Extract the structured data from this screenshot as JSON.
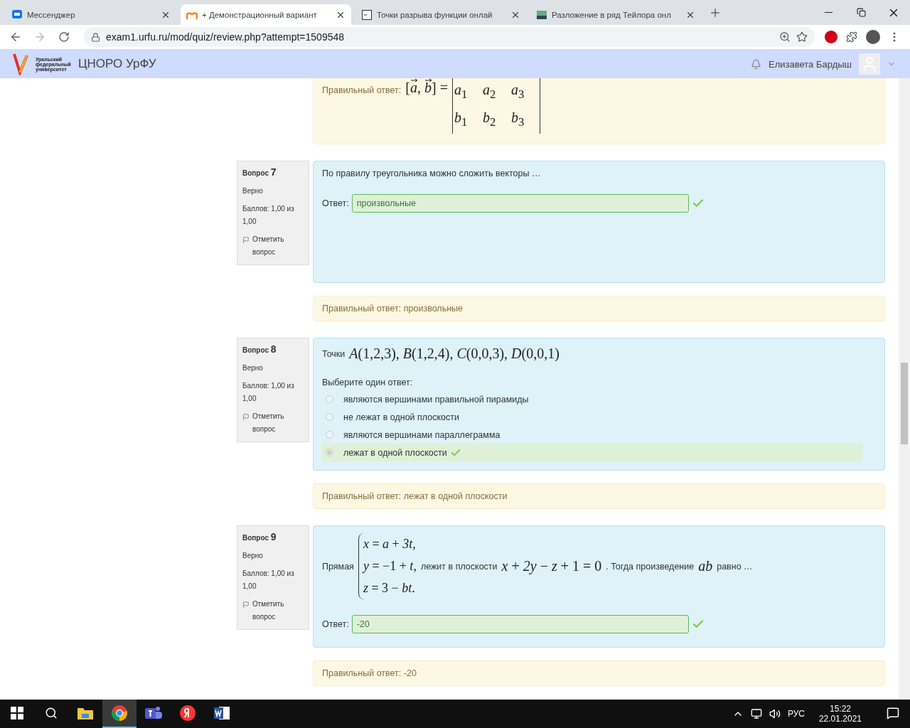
{
  "browser": {
    "tabs": [
      {
        "title": "Мессенджер",
        "selected": false
      },
      {
        "title": "+ Демонстрационный вариант",
        "selected": true
      },
      {
        "title": "Точки разрыва функции онлай",
        "selected": false
      },
      {
        "title": "Разложение в ряд Тейлора онл",
        "selected": false
      }
    ],
    "url": "exam1.urfu.ru/mod/quiz/review.php?attempt=1509548"
  },
  "site": {
    "logo_text": "Уральский федеральный университет",
    "name": "ЦНОРО УрФУ",
    "user": "Елизавета Бардыш"
  },
  "previous_feedback": {
    "label": "Правильный ответ:",
    "open": "[",
    "vectors": [
      "a",
      "b"
    ],
    "separator": ",",
    "close": "] =",
    "matrix": [
      [
        "*a*$_{1}$",
        "*a*$_{2}$",
        "*a*$_{3}$"
      ],
      [
        "*b*$_{1}$",
        "*b*$_{2}$",
        "*b*$_{3}$"
      ]
    ]
  },
  "questions": [
    {
      "kind": "short_answer",
      "label": "Вопрос",
      "number": "7",
      "status": "Верно",
      "grade": "Баллов: 1,00 из 1,00",
      "flag": "Отметить вопрос",
      "text": [
        {
          "kind": "text",
          "value": "По правилу треугольника можно сложить векторы …"
        }
      ],
      "answer_label": "Ответ:",
      "answer": "произвольные",
      "correct": true,
      "feedback": "Правильный ответ: произвольные"
    },
    {
      "kind": "multichoice",
      "label": "Вопрос",
      "number": "8",
      "status": "Верно",
      "grade": "Баллов: 1,00 из 1,00",
      "flag": "Отметить вопрос",
      "text": [
        {
          "kind": "text",
          "value": "Точки"
        },
        {
          "kind": "math",
          "value": "*A*(1,2,3), *B*(1,2,4), *C*(0,0,3), *D*(0,0,1)"
        }
      ],
      "instruction": "Выберите один ответ:",
      "options": [
        {
          "label": "являются вершинами правильной пирамиды",
          "selected": false,
          "correct": false
        },
        {
          "label": "не лежат в одной плоскости",
          "selected": false,
          "correct": false
        },
        {
          "label": "являются вершинами параллеграмма",
          "selected": false,
          "correct": false
        },
        {
          "label": "лежат в одной плоскости",
          "selected": true,
          "correct": true
        }
      ],
      "feedback": "Правильный ответ: лежат в одной плоскости"
    },
    {
      "kind": "short_answer",
      "label": "Вопрос",
      "number": "9",
      "status": "Верно",
      "grade": "Баллов: 1,00 из 1,00",
      "flag": "Отметить вопрос",
      "text": [
        {
          "kind": "text",
          "value": "Прямая"
        },
        {
          "kind": "system",
          "lines": [
            "*x* = *a* + *3t*,",
            "*y* = −1 + *t*,",
            "*z* = 3 − *bt*."
          ]
        },
        {
          "kind": "text",
          "value": "лежит в плоскости"
        },
        {
          "kind": "math",
          "value": "*x* + *2y* − *z* + 1 = 0"
        },
        {
          "kind": "text",
          "value": ". Тогда произведение"
        },
        {
          "kind": "math",
          "value": "*ab*"
        },
        {
          "kind": "text",
          "value": "равно …"
        }
      ],
      "answer_label": "Ответ:",
      "answer": "-20",
      "correct": true,
      "feedback": "Правильный ответ: -20"
    }
  ],
  "taskbar": {
    "apps": [
      {
        "selected": false
      },
      {
        "selected": true
      },
      {
        "selected": false
      },
      {
        "selected": false
      },
      {
        "selected": false
      }
    ],
    "language": "РУС",
    "time": "15:22",
    "date": "22.01.2021"
  }
}
